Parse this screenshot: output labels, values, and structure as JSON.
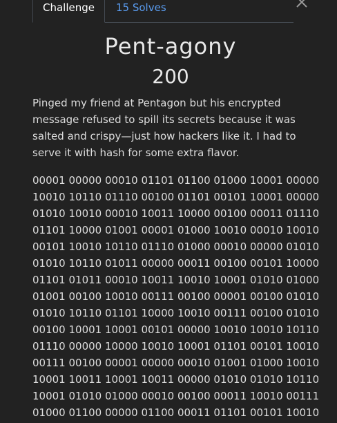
{
  "tabs": {
    "challenge_label": "Challenge",
    "solves_label": "15 Solves"
  },
  "challenge": {
    "title": "Pent-agony",
    "points": "200",
    "description": "Pinged my friend at Pentagon but his encrypted message refused to spill its secrets because it was salted and crispy—just how hackers like it. I had to serve it with hash for some extra flavor.",
    "binary_lines": [
      "00001 00000 00010 01101 01100 01000 10001 00000",
      "10010 10110 01110 00100 01101 00101 10001 00000",
      "01010 10010 00010 10011 10000 00100 00011 01110",
      "01101 10000 01001 00001 01000 10010 00010 10010",
      "00101 10010 10110 01110 01000 00010 00000 01010",
      "01010 10110 01011 00000 00011 00100 00101 10000",
      "01101 01011 00010 10011 10010 10001 01010 01000",
      "01001 00100 10010 00111 00100 00001 00100 01010",
      "01010 10110 01101 10000 10010 00111 00100 01010",
      "00100 10001 10001 00101 00000 10010 10010 10110",
      "01110 00000 10000 10010 10001 01101 00101 10010",
      "00111 00100 00001 00000 00010 01001 01000 10010",
      "10001 10011 10001 10011 00000 01010 01010 10110",
      "10001 01010 01000 00010 00100 00011 10010 00111",
      "01000 01100 00000 01100 00011 01101 00101 10010"
    ]
  },
  "colors": {
    "background": "#222222",
    "accent": "#5a9cf0",
    "text": "#dddddd"
  },
  "icons": {
    "close": "close-icon"
  }
}
